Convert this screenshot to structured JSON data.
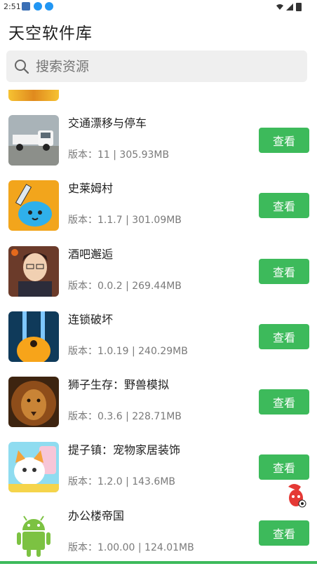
{
  "status": {
    "time": "2:51"
  },
  "header": {
    "title": "天空软件库"
  },
  "search": {
    "placeholder": "搜索资源"
  },
  "list": [
    {
      "name": "交通漂移与停车",
      "meta": "版本：11  |  305.93MB",
      "button": "查看",
      "thumb": "truck"
    },
    {
      "name": "史莱姆村",
      "meta": "版本：1.1.7  |  301.09MB",
      "button": "查看",
      "thumb": "slime"
    },
    {
      "name": "酒吧邂逅",
      "meta": "版本：0.0.2  |  269.44MB",
      "button": "查看",
      "thumb": "anime"
    },
    {
      "name": "连锁破坏",
      "meta": "版本：1.0.19  |  240.29MB",
      "button": "查看",
      "thumb": "chain"
    },
    {
      "name": "狮子生存：野兽模拟",
      "meta": "版本：0.3.6  |  228.71MB",
      "button": "查看",
      "thumb": "lion"
    },
    {
      "name": "提子镇：宠物家居装饰",
      "meta": "版本：1.2.0  |  143.6MB",
      "button": "查看",
      "thumb": "cat"
    },
    {
      "name": "办公楼帝国",
      "meta": "版本：1.00.00  |  124.01MB",
      "button": "查看",
      "thumb": "android"
    }
  ]
}
